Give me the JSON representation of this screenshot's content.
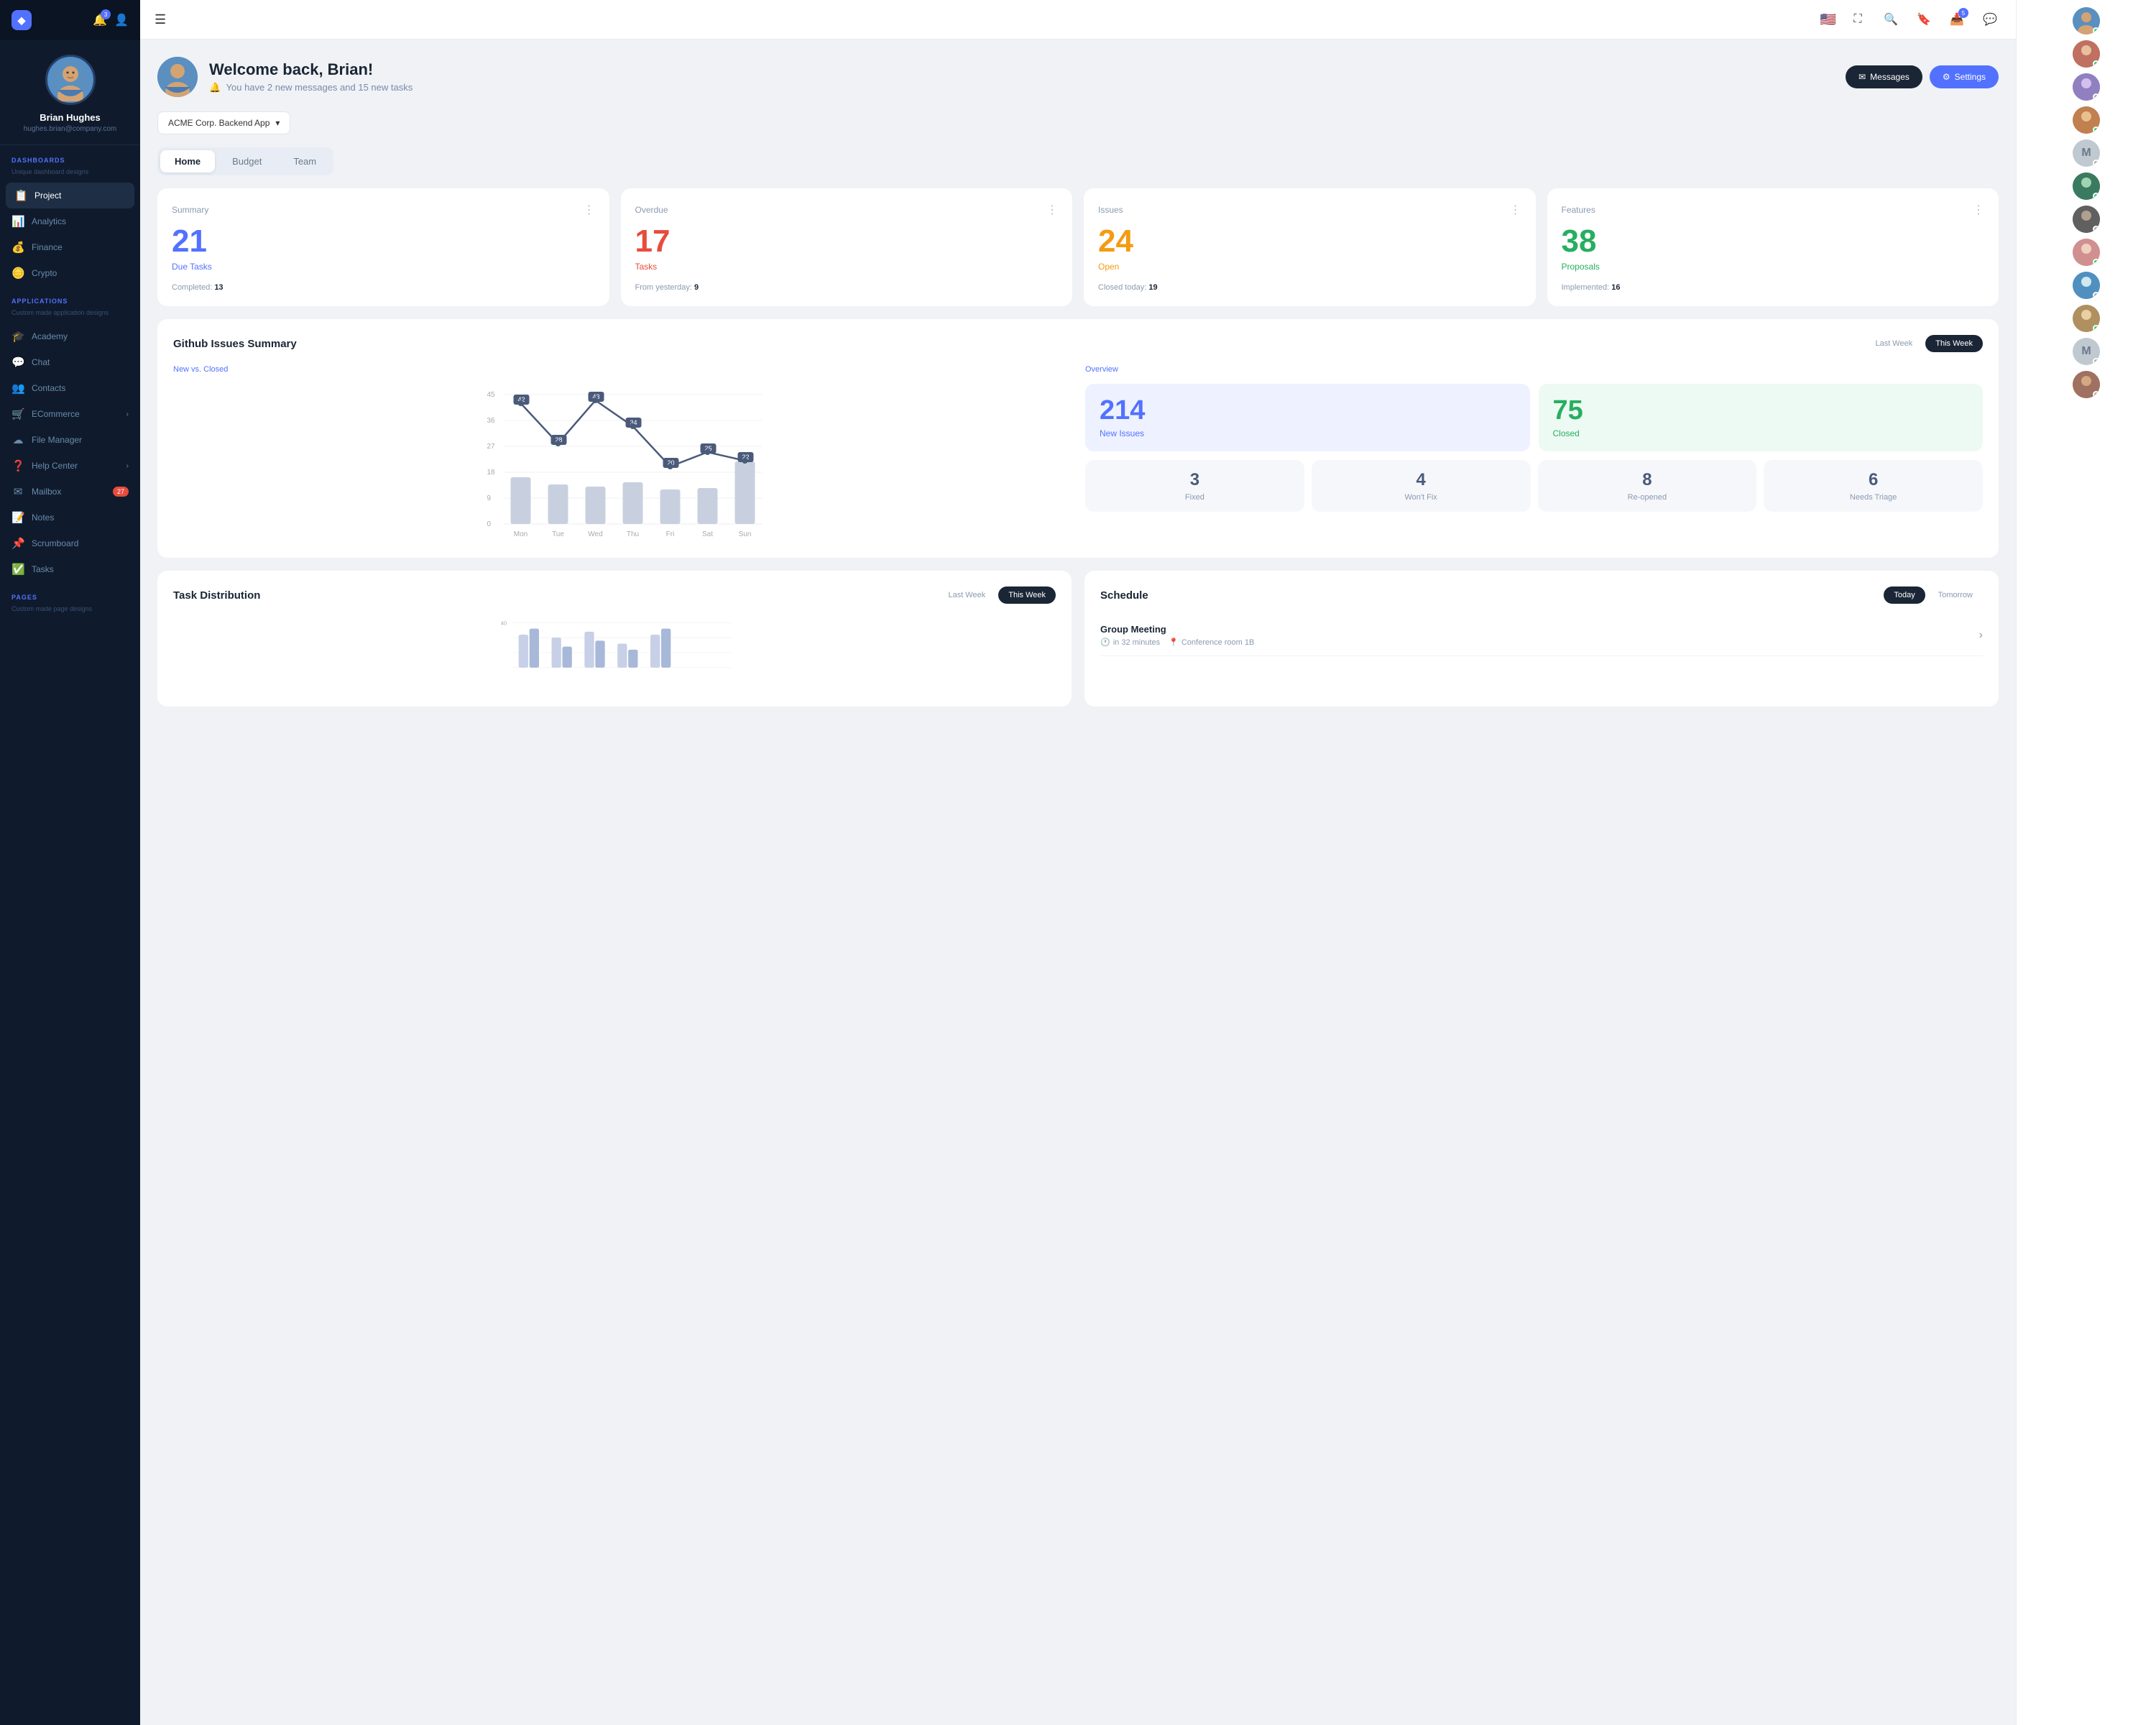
{
  "sidebar": {
    "logo": "◆",
    "notification_badge": "3",
    "user": {
      "name": "Brian Hughes",
      "email": "hughes.brian@company.com"
    },
    "dashboards_section": "DASHBOARDS",
    "dashboards_sub": "Unique dashboard designs",
    "nav_items": [
      {
        "id": "project",
        "icon": "📋",
        "label": "Project",
        "active": true
      },
      {
        "id": "analytics",
        "icon": "📊",
        "label": "Analytics",
        "active": false
      },
      {
        "id": "finance",
        "icon": "💰",
        "label": "Finance",
        "active": false
      },
      {
        "id": "crypto",
        "icon": "🪙",
        "label": "Crypto",
        "active": false
      }
    ],
    "applications_section": "APPLICATIONS",
    "applications_sub": "Custom made application designs",
    "app_items": [
      {
        "id": "academy",
        "icon": "🎓",
        "label": "Academy",
        "badge": null,
        "arrow": false
      },
      {
        "id": "chat",
        "icon": "💬",
        "label": "Chat",
        "badge": null,
        "arrow": false
      },
      {
        "id": "contacts",
        "icon": "👥",
        "label": "Contacts",
        "badge": null,
        "arrow": false
      },
      {
        "id": "ecommerce",
        "icon": "🛒",
        "label": "ECommerce",
        "badge": null,
        "arrow": true
      },
      {
        "id": "file-manager",
        "icon": "☁",
        "label": "File Manager",
        "badge": null,
        "arrow": false
      },
      {
        "id": "help-center",
        "icon": "❓",
        "label": "Help Center",
        "badge": null,
        "arrow": true
      },
      {
        "id": "mailbox",
        "icon": "✉",
        "label": "Mailbox",
        "badge": "27",
        "arrow": false
      },
      {
        "id": "notes",
        "icon": "📝",
        "label": "Notes",
        "badge": null,
        "arrow": false
      },
      {
        "id": "scrumboard",
        "icon": "📌",
        "label": "Scrumboard",
        "badge": null,
        "arrow": false
      },
      {
        "id": "tasks",
        "icon": "✅",
        "label": "Tasks",
        "badge": null,
        "arrow": false
      }
    ],
    "pages_section": "PAGES",
    "pages_sub": "Custom made page designs"
  },
  "topbar": {
    "inbox_badge": "5"
  },
  "header": {
    "welcome": "Welcome back, Brian!",
    "subtitle": "You have 2 new messages and 15 new tasks",
    "bell_icon": "🔔",
    "messages_btn": "Messages",
    "settings_btn": "Settings"
  },
  "project_selector": {
    "label": "ACME Corp. Backend App"
  },
  "tabs": [
    {
      "id": "home",
      "label": "Home",
      "active": true
    },
    {
      "id": "budget",
      "label": "Budget",
      "active": false
    },
    {
      "id": "team",
      "label": "Team",
      "active": false
    }
  ],
  "stat_cards": [
    {
      "title": "Summary",
      "number": "21",
      "number_class": "blue",
      "label": "Due Tasks",
      "label_class": "blue",
      "footer_key": "Completed:",
      "footer_val": "13"
    },
    {
      "title": "Overdue",
      "number": "17",
      "number_class": "red",
      "label": "Tasks",
      "label_class": "red",
      "footer_key": "From yesterday:",
      "footer_val": "9"
    },
    {
      "title": "Issues",
      "number": "24",
      "number_class": "orange",
      "label": "Open",
      "label_class": "orange",
      "footer_key": "Closed today:",
      "footer_val": "19"
    },
    {
      "title": "Features",
      "number": "38",
      "number_class": "green",
      "label": "Proposals",
      "label_class": "green",
      "footer_key": "Implemented:",
      "footer_val": "16"
    }
  ],
  "github_issues": {
    "title": "Github Issues Summary",
    "last_week_label": "Last Week",
    "this_week_label": "This Week",
    "chart": {
      "subtitle": "New vs. Closed",
      "days": [
        "Mon",
        "Tue",
        "Wed",
        "Thu",
        "Fri",
        "Sat",
        "Sun"
      ],
      "line_points": [
        42,
        28,
        43,
        34,
        20,
        25,
        22
      ],
      "bar_values": [
        30,
        25,
        22,
        28,
        18,
        20,
        35
      ]
    },
    "overview": {
      "subtitle": "Overview",
      "new_issues": "214",
      "new_issues_label": "New Issues",
      "closed": "75",
      "closed_label": "Closed",
      "metrics": [
        {
          "value": "3",
          "label": "Fixed"
        },
        {
          "value": "4",
          "label": "Won't Fix"
        },
        {
          "value": "8",
          "label": "Re-opened"
        },
        {
          "value": "6",
          "label": "Needs Triage"
        }
      ]
    }
  },
  "task_distribution": {
    "title": "Task Distribution",
    "last_week_label": "Last Week",
    "this_week_label": "This Week",
    "bar_max": 40,
    "bar_top_label": "40"
  },
  "schedule": {
    "title": "Schedule",
    "today_label": "Today",
    "tomorrow_label": "Tomorrow",
    "event": {
      "title": "Group Meeting",
      "time_icon": "🕐",
      "time_text": "in 32 minutes",
      "location_icon": "📍",
      "location_text": "Conference room 1B"
    }
  },
  "right_sidebar": {
    "avatars": [
      {
        "color": "#4a90d9",
        "online": true,
        "initial": ""
      },
      {
        "color": "#e74c3c",
        "online": true,
        "initial": ""
      },
      {
        "color": "#8a70c0",
        "online": false,
        "initial": ""
      },
      {
        "color": "#d4a373",
        "online": true,
        "initial": ""
      },
      {
        "color": "#808080",
        "online": false,
        "initial": "M"
      },
      {
        "color": "#2ecc71",
        "online": true,
        "initial": ""
      },
      {
        "color": "#e67e22",
        "online": false,
        "initial": ""
      },
      {
        "color": "#e0a0a0",
        "online": true,
        "initial": ""
      },
      {
        "color": "#5090c0",
        "online": false,
        "initial": ""
      },
      {
        "color": "#c0a870",
        "online": true,
        "initial": ""
      },
      {
        "color": "#808080",
        "online": false,
        "initial": "M"
      },
      {
        "color": "#d4a373",
        "online": false,
        "initial": ""
      }
    ]
  }
}
